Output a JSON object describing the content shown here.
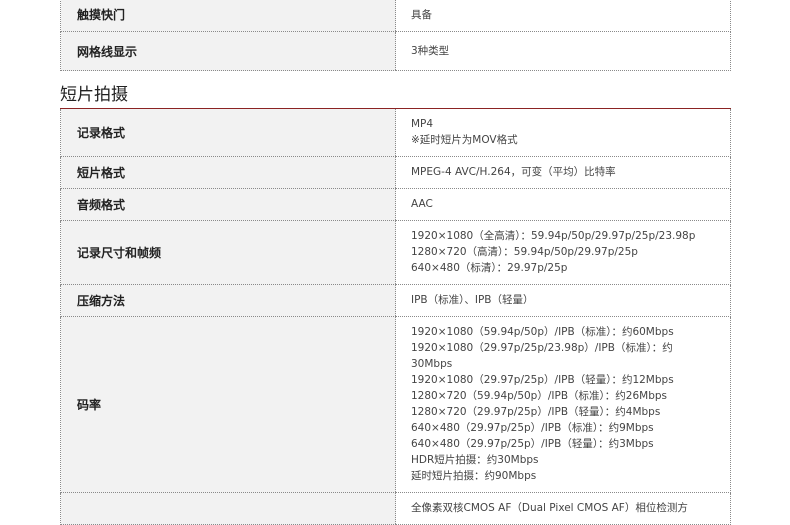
{
  "top_rows": [
    {
      "label": "触摸快门",
      "value": "具备"
    },
    {
      "label": "网格线显示",
      "value": "3种类型"
    }
  ],
  "section": {
    "title": "短片拍摄",
    "rule_color": "#8b2323"
  },
  "rows": [
    {
      "label": "记录格式",
      "value": "MP4\n※延时短片为MOV格式"
    },
    {
      "label": "短片格式",
      "value": "MPEG-4 AVC/H.264，可变（平均）比特率"
    },
    {
      "label": "音频格式",
      "value": "AAC"
    },
    {
      "label": "记录尺寸和帧频",
      "value": "1920×1080（全高清）：59.94p/50p/29.97p/25p/23.98p\n1280×720（高清）：59.94p/50p/29.97p/25p\n640×480（标清）：29.97p/25p"
    },
    {
      "label": "压缩方法",
      "value": "IPB（标准）、IPB（轻量）"
    },
    {
      "label": "码率",
      "value": "1920×1080（59.94p/50p）/IPB（标准）：约60Mbps\n1920×1080（29.97p/25p/23.98p）/IPB（标准）：约\n30Mbps\n1920×1080（29.97p/25p）/IPB（轻量）：约12Mbps\n1280×720（59.94p/50p）/IPB（标准）：约26Mbps\n1280×720（29.97p/25p）/IPB（轻量）：约4Mbps\n640×480（29.97p/25p）/IPB（标准）：约9Mbps\n640×480（29.97p/25p）/IPB（轻量）：约3Mbps\nHDR短片拍摄：约30Mbps\n延时短片拍摄：约90Mbps"
    },
    {
      "label": "",
      "value": "全像素双核CMOS AF（Dual Pixel CMOS AF）相位检测方"
    }
  ]
}
